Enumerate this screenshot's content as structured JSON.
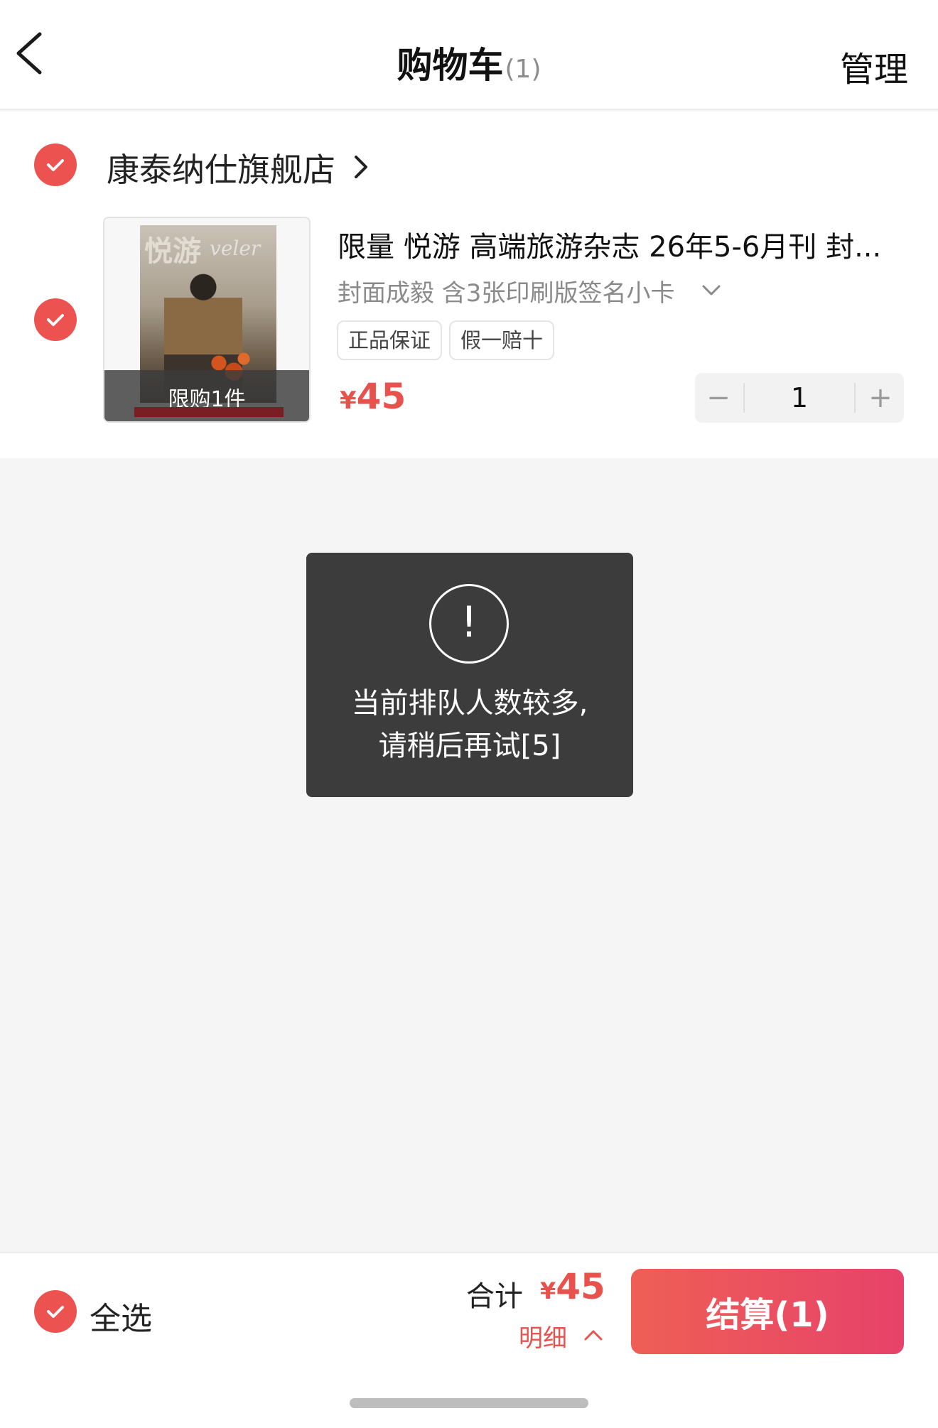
{
  "header": {
    "title": "购物车",
    "count": "(1)",
    "manage_label": "管理",
    "back_icon": "chevron-left-icon"
  },
  "store": {
    "name": "康泰纳仕旗舰店",
    "selected": true,
    "arrow_icon": "chevron-right-icon"
  },
  "item": {
    "selected": true,
    "image_text": {
      "cover_title": "悦游",
      "cover_sub": "veler"
    },
    "limit_label": "限购1件",
    "title": "限量 悦游 高端旅游杂志 26年5-6月刊 封...",
    "spec": "封面成毅 含3张印刷版签名小卡",
    "spec_icon": "chevron-down-icon",
    "tags": [
      "正品保证",
      "假一赔十"
    ],
    "price_symbol": "¥",
    "price": "45",
    "quantity": "1",
    "minus_label": "−",
    "plus_label": "+"
  },
  "toast": {
    "icon_symbol": "!",
    "line1": "当前排队人数较多,",
    "line2": "请稍后再试[5]"
  },
  "footer": {
    "select_all_label": "全选",
    "total_label": "合计",
    "total_symbol": "¥",
    "total_value": "45",
    "detail_label": "明细",
    "detail_icon": "chevron-up-icon",
    "checkout_label": "结算(1)"
  },
  "colors": {
    "accent": "#ec5350",
    "price": "#e8524d",
    "checkout_start": "#ee5f55",
    "checkout_end": "#e7426a",
    "toast_bg": "#343434",
    "page_bg": "#f5f5f5"
  }
}
